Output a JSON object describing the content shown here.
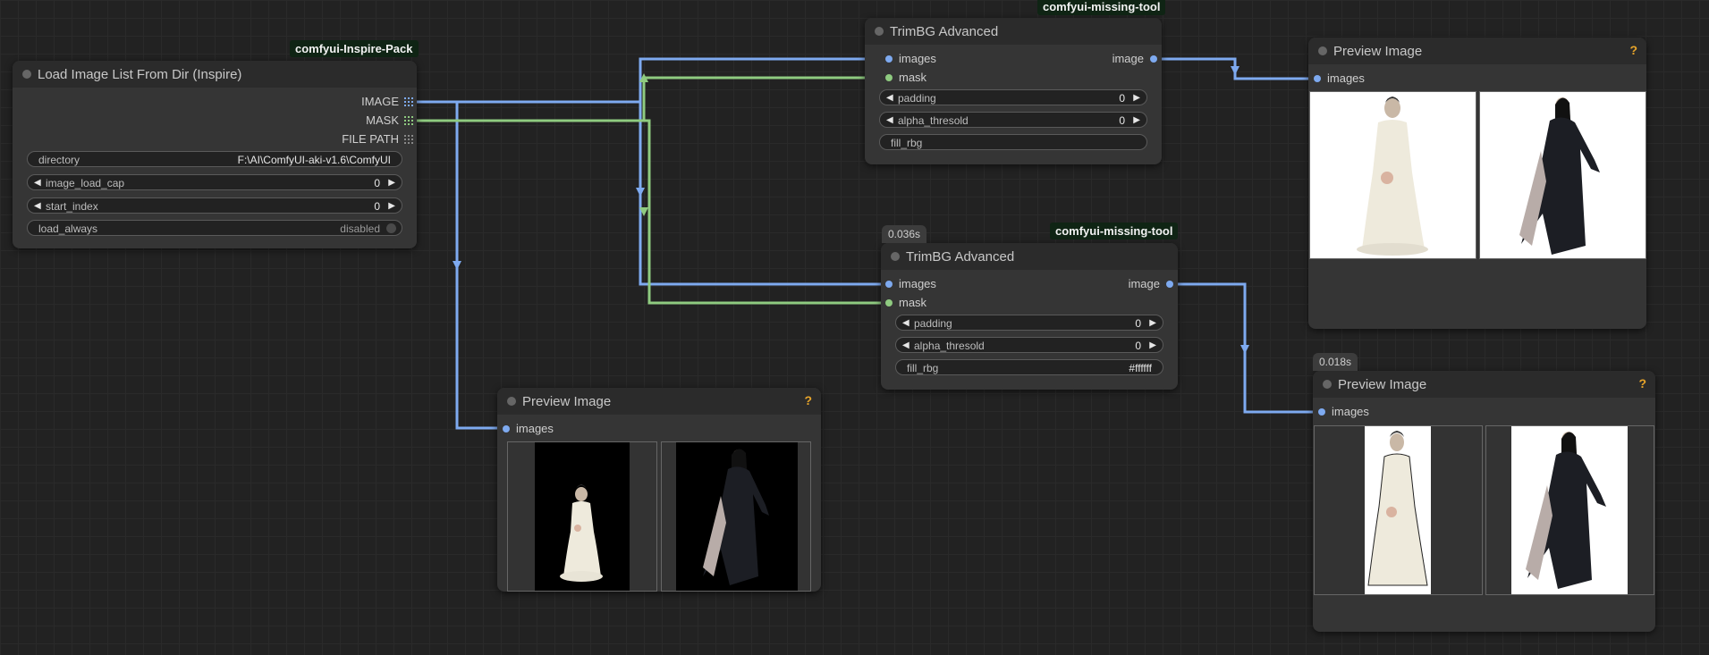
{
  "nodes": {
    "load": {
      "title": "Load Image List From Dir (Inspire)",
      "badge": "comfyui-Inspire-Pack",
      "outputs": [
        "IMAGE",
        "MASK",
        "FILE PATH"
      ],
      "widgets": {
        "directory": {
          "label": "directory",
          "value": "F:\\AI\\ComfyUI-aki-v1.6\\ComfyUI"
        },
        "image_load_cap": {
          "label": "image_load_cap",
          "value": "0"
        },
        "start_index": {
          "label": "start_index",
          "value": "0"
        },
        "load_always": {
          "label": "load_always",
          "value": "disabled"
        }
      }
    },
    "trim1": {
      "title": "TrimBG Advanced",
      "badge": "comfyui-missing-tool",
      "inputs": [
        "images",
        "mask"
      ],
      "output": "image",
      "widgets": {
        "padding": {
          "label": "padding",
          "value": "0"
        },
        "alpha": {
          "label": "alpha_thresold",
          "value": "0"
        },
        "fill": {
          "label": "fill_rbg",
          "value": ""
        }
      }
    },
    "trim2": {
      "title": "TrimBG Advanced",
      "badge": "comfyui-missing-tool",
      "time": "0.036s",
      "inputs": [
        "images",
        "mask"
      ],
      "output": "image",
      "widgets": {
        "padding": {
          "label": "padding",
          "value": "0"
        },
        "alpha": {
          "label": "alpha_thresold",
          "value": "0"
        },
        "fill": {
          "label": "fill_rbg",
          "value": "#ffffff"
        }
      }
    },
    "preview1": {
      "title": "Preview Image",
      "input": "images",
      "help": "?"
    },
    "preview2": {
      "title": "Preview Image",
      "input": "images",
      "help": "?"
    },
    "preview3": {
      "title": "Preview Image",
      "input": "images",
      "help": "?",
      "time": "0.018s"
    }
  },
  "colors": {
    "image_wire": "#7eaaf0",
    "mask_wire": "#8fcb80",
    "help": "#e8a52a"
  },
  "icons": {
    "arrow_left": "◀",
    "arrow_right": "▶"
  }
}
